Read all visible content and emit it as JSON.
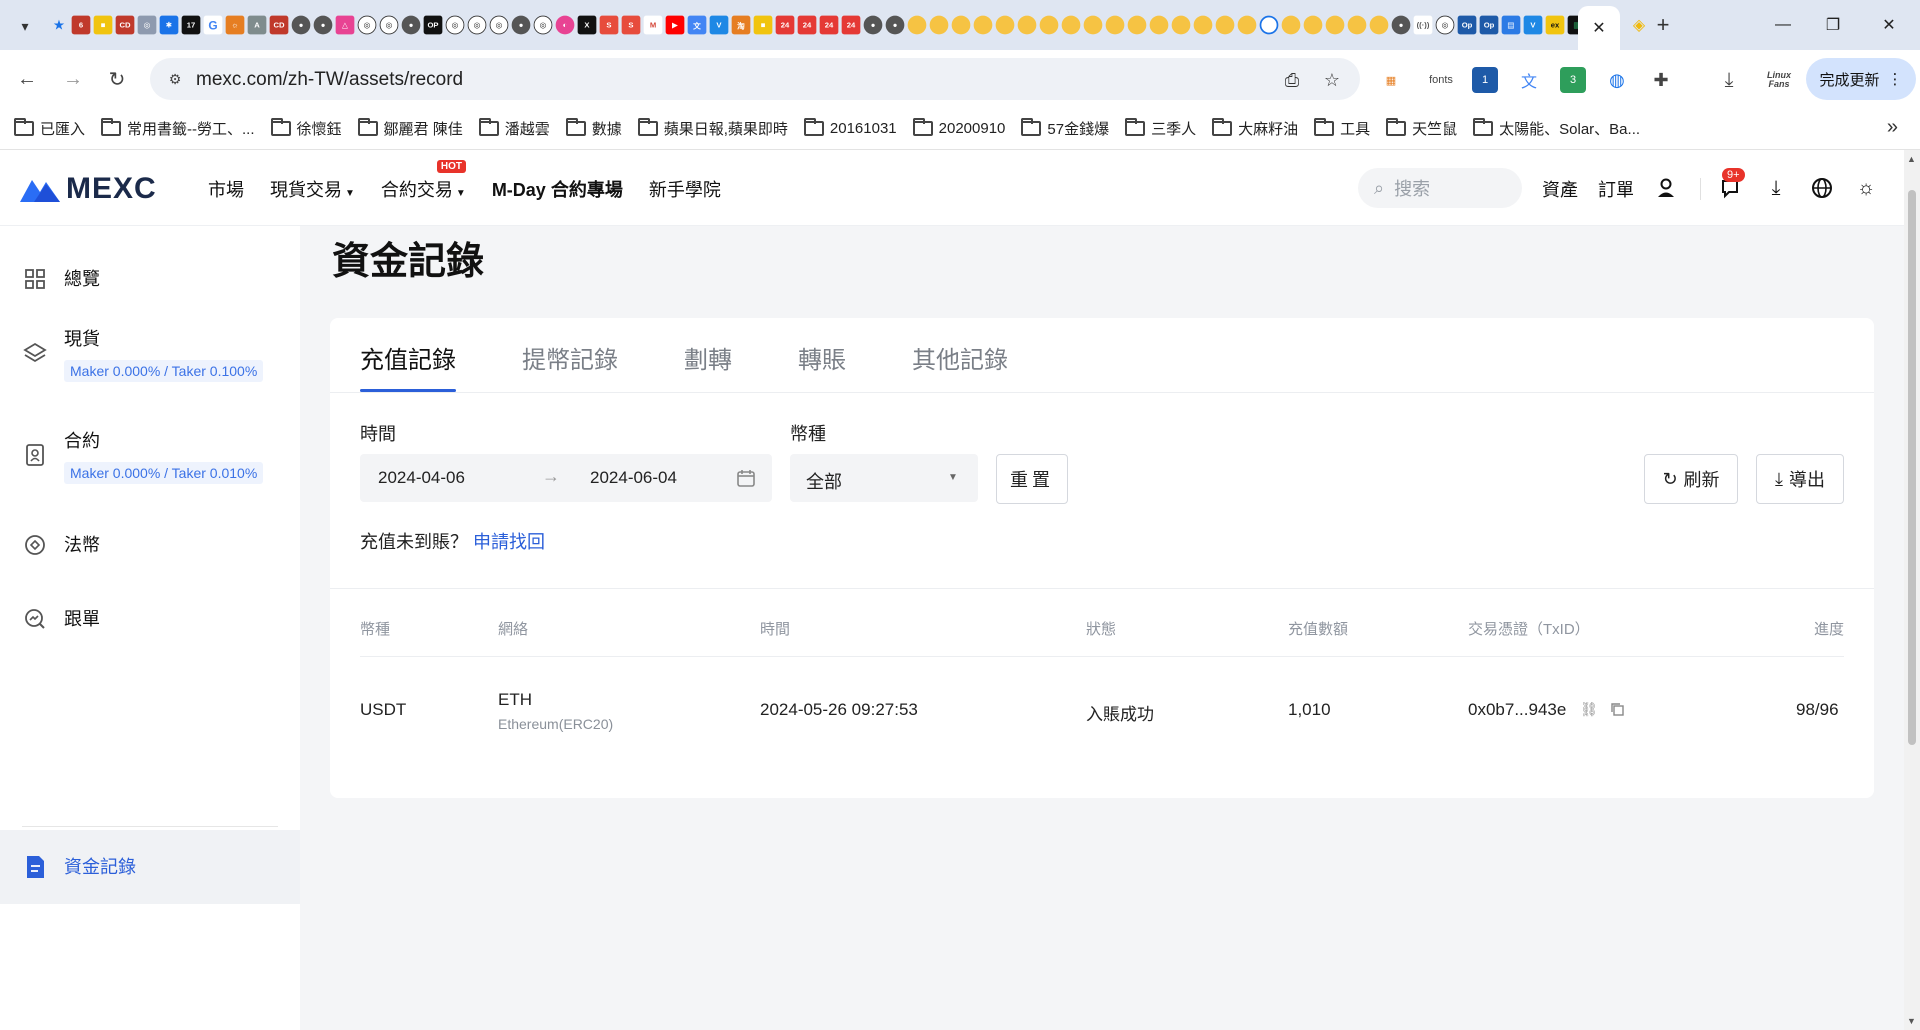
{
  "browser": {
    "url": "mexc.com/zh-TW/assets/record",
    "update_label": "完成更新",
    "ext_fonts": "fonts",
    "ext_linux_line1": "Linux",
    "ext_linux_line2": "Fans",
    "ext_badge_1": "1",
    "ext_badge_3": "3",
    "bookmarks": [
      "已匯入",
      "常用書籤--勞工、...",
      "徐懷鈺",
      "鄒麗君 陳佳",
      "潘越雲",
      "數據",
      "蘋果日報,蘋果即時",
      "20161031",
      "20200910",
      "57金錢爆",
      "三季人",
      "大麻籽油",
      "工具",
      "天竺鼠",
      "太陽能、Solar、Ba..."
    ]
  },
  "colors": {
    "accent": "#2b5fd9",
    "hot_badge": "#e8332a",
    "logo_blue": "#2a6df5"
  },
  "header": {
    "logo_text": "MEXC",
    "nav": [
      "市場",
      "現貨交易",
      "合約交易",
      "M-Day 合約專場",
      "新手學院"
    ],
    "hot_label": "HOT",
    "search_placeholder": "搜索",
    "assets_label": "資產",
    "orders_label": "訂單",
    "notif_badge": "9+"
  },
  "sidebar": {
    "items": [
      {
        "label": "總覽",
        "icon": "dashboard-icon"
      },
      {
        "label": "現貨",
        "icon": "layers-icon",
        "fee": "Maker 0.000% / Taker 0.100%"
      },
      {
        "label": "合約",
        "icon": "contract-icon",
        "fee": "Maker 0.000% / Taker 0.010%"
      },
      {
        "label": "法幣",
        "icon": "fiat-icon"
      },
      {
        "label": "跟單",
        "icon": "copy-trade-icon"
      },
      {
        "label": "資金記錄",
        "icon": "document-icon"
      }
    ]
  },
  "main": {
    "title": "資金記錄",
    "tabs": [
      "充值記錄",
      "提幣記錄",
      "劃轉",
      "轉賬",
      "其他記錄"
    ],
    "filters": {
      "time_label": "時間",
      "start_date": "2024-04-06",
      "end_date": "2024-06-04",
      "coin_label": "幣種",
      "coin_value": "全部",
      "reset_label": "重置",
      "refresh_label": "刷新",
      "export_label": "導出"
    },
    "notice_text": "充值未到賬？",
    "notice_link": "申請找回",
    "table": {
      "headers": [
        "幣種",
        "網絡",
        "時間",
        "狀態",
        "充值數額",
        "交易憑證（TxID）",
        "進度"
      ],
      "rows": [
        {
          "coin": "USDT",
          "network": "ETH",
          "network_sub": "Ethereum(ERC20)",
          "time": "2024-05-26 09:27:53",
          "status": "入賬成功",
          "amount": "1,010",
          "txid": "0x0b7...943e",
          "progress": "98/96"
        }
      ]
    }
  }
}
